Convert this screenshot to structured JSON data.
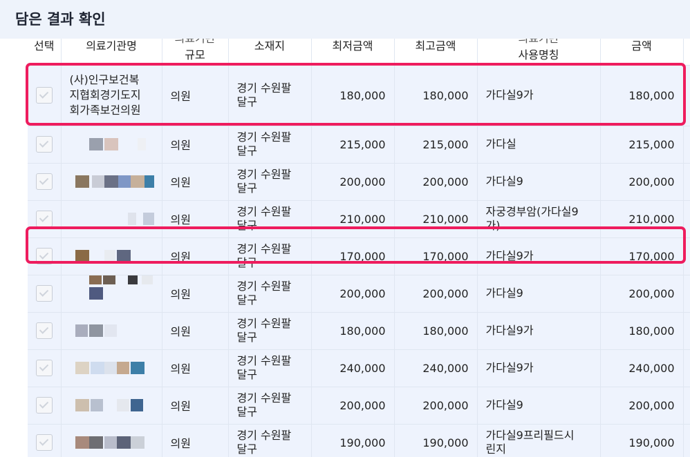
{
  "header": {
    "title": "담은 결과 확인"
  },
  "table": {
    "columns": {
      "select": "선택",
      "name": "의료기관명",
      "size_upper": "의료기관",
      "size": "규모",
      "location": "소재지",
      "min": "최저금액",
      "max": "최고금액",
      "use_upper": "의료기관",
      "use": "사용명칭",
      "amount_upper": "",
      "amount": "금액"
    },
    "rows": [
      {
        "name": "(사)인구보건복\n지협회경기도지\n회가족보건의원",
        "size": "의원",
        "location": "경기 수원팔\n달구",
        "min": "180,000",
        "max": "180,000",
        "use": "가다실9가",
        "amount": "180,000",
        "blur_colors": []
      },
      {
        "name": "",
        "size": "의원",
        "location": "경기 수원팔\n달구",
        "min": "215,000",
        "max": "215,000",
        "use": "가다실",
        "amount": "215,000",
        "blur_colors": [
          "#9aa0ad",
          "#d9c4bd",
          "#eef0f4"
        ]
      },
      {
        "name": "",
        "size": "의원",
        "location": "경기 수원팔\n달구",
        "min": "200,000",
        "max": "200,000",
        "use": "가다실9",
        "amount": "200,000",
        "blur_colors": [
          "#8a7760",
          "#c9ccd6",
          "#6b7186",
          "#7f97c6",
          "#c6b09a",
          "#3d7fa8"
        ]
      },
      {
        "name": "",
        "size": "의원",
        "location": "경기 수원팔\n달구",
        "min": "210,000",
        "max": "210,000",
        "use": "자궁경부암(가다실9\n가)",
        "amount": "210,000",
        "blur_colors": [
          "#dfe3ec",
          "#c4ccdc"
        ]
      },
      {
        "name": "",
        "size": "의원",
        "location": "경기 수원팔\n달구",
        "min": "170,000",
        "max": "170,000",
        "use": "가다실9가",
        "amount": "170,000",
        "blur_colors": [
          "#8a6a45",
          "#e9ecf1",
          "#5f6780"
        ]
      },
      {
        "name": "",
        "size": "의원",
        "location": "경기 수원팔\n달구",
        "min": "200,000",
        "max": "200,000",
        "use": "가다실9",
        "amount": "200,000",
        "blur_colors": [
          "#8a6d52",
          "#6d5f53",
          "#3a3a3e",
          "#e6e9ee",
          "#4f5a80"
        ]
      },
      {
        "name": "",
        "size": "의원",
        "location": "경기 수원팔\n달구",
        "min": "180,000",
        "max": "180,000",
        "use": "가다실9가",
        "amount": "180,000",
        "blur_colors": [
          "#a9adbd",
          "#8f95a0",
          "#e2e6f0"
        ]
      },
      {
        "name": "",
        "size": "의원",
        "location": "경기 수원팔\n달구",
        "min": "240,000",
        "max": "240,000",
        "use": "가다실9가",
        "amount": "240,000",
        "blur_colors": [
          "#ddd3c4",
          "#cfdcef",
          "#dce2ec",
          "#c5a98f",
          "#3d7fa8"
        ]
      },
      {
        "name": "",
        "size": "의원",
        "location": "경기 수원팔\n달구",
        "min": "200,000",
        "max": "200,000",
        "use": "가다실9",
        "amount": "200,000",
        "blur_colors": [
          "#cdbfae",
          "#b8c0cf",
          "#e5e8ee",
          "#3f6590"
        ]
      },
      {
        "name": "",
        "size": "의원",
        "location": "경기 수원팔\n달구",
        "min": "190,000",
        "max": "190,000",
        "use": "가다실9프리필드시\n린지",
        "amount": "190,000",
        "blur_colors": [
          "#a88a7c",
          "#6e6e72",
          "#b9bdcb",
          "#5c6378",
          "#cbd0d8"
        ]
      }
    ]
  },
  "highlight_color": "#ee1c5e"
}
